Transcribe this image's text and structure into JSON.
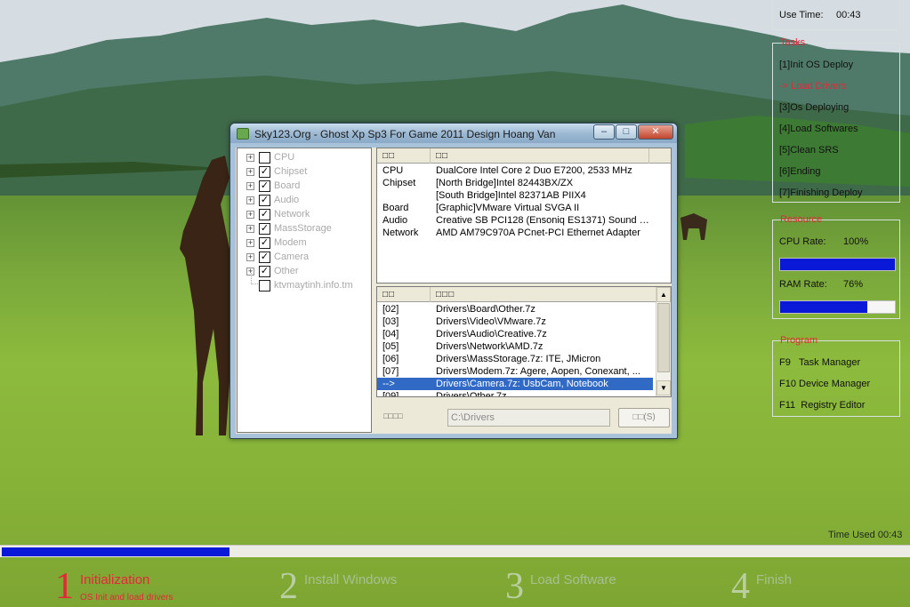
{
  "window": {
    "title": "Sky123.Org - Ghost Xp Sp3 For Game 2011 Design Hoang Van",
    "min_glyph": "–",
    "max_glyph": "□",
    "close_glyph": "✕"
  },
  "tree": {
    "items": [
      {
        "label": "CPU",
        "checked": false
      },
      {
        "label": "Chipset",
        "checked": true
      },
      {
        "label": "Board",
        "checked": true
      },
      {
        "label": "Audio",
        "checked": true
      },
      {
        "label": "Network",
        "checked": true
      },
      {
        "label": "MassStorage",
        "checked": true
      },
      {
        "label": "Modem",
        "checked": true
      },
      {
        "label": "Camera",
        "checked": true
      },
      {
        "label": "Other",
        "checked": true
      },
      {
        "label": "ktvmaytinh.info.tm",
        "checked": false
      }
    ]
  },
  "hardware_list": {
    "headers": [
      "□□",
      "□□"
    ],
    "rows": [
      {
        "type": "CPU",
        "value": "DualCore Intel Core 2 Duo E7200, 2533 MHz"
      },
      {
        "type": "Chipset",
        "value": "[North Bridge]Intel 82443BX/ZX"
      },
      {
        "type": "",
        "value": "[South Bridge]Intel 82371AB PIIX4"
      },
      {
        "type": "Board",
        "value": "[Graphic]VMware Virtual SVGA II"
      },
      {
        "type": "Audio",
        "value": "Creative SB PCI128 (Ensoniq ES1371) Sound C..."
      },
      {
        "type": "Network",
        "value": "AMD AM79C970A PCnet-PCI Ethernet Adapter"
      }
    ]
  },
  "driver_list": {
    "headers": [
      "□□",
      "□□□"
    ],
    "rows": [
      {
        "id": "[02]",
        "path": "Drivers\\Board\\Other.7z"
      },
      {
        "id": "[03]",
        "path": "Drivers\\Video\\VMware.7z"
      },
      {
        "id": "[04]",
        "path": "Drivers\\Audio\\Creative.7z"
      },
      {
        "id": "[05]",
        "path": "Drivers\\Network\\AMD.7z"
      },
      {
        "id": "[06]",
        "path": "Drivers\\MassStorage.7z: ITE, JMicron"
      },
      {
        "id": "[07]",
        "path": "Drivers\\Modem.7z: Agere, Aopen, Conexant, ..."
      },
      {
        "id": "-->",
        "path": "Drivers\\Camera.7z: UsbCam, Notebook"
      },
      {
        "id": "[09]",
        "path": "Drivers\\Other.7z"
      }
    ],
    "selected_index": 6,
    "scroll_up": "▲",
    "scroll_down": "▼"
  },
  "path_bar": {
    "label": "□□□□",
    "value": "C:\\Drivers",
    "button": "□□(S)"
  },
  "use_time": {
    "label": "Use Time:",
    "value": "00:43"
  },
  "tasks": {
    "title": "Tasks",
    "items": [
      {
        "label": "[1]Init OS Deploy",
        "active": false
      },
      {
        "label": "-> Load Drivers",
        "active": true
      },
      {
        "label": "[3]Os Deploying",
        "active": false
      },
      {
        "label": "[4]Load Softwares",
        "active": false
      },
      {
        "label": "[5]Clean SRS",
        "active": false
      },
      {
        "label": "[6]Ending",
        "active": false
      },
      {
        "label": "[7]Finishing Deploy",
        "active": false
      }
    ]
  },
  "resource": {
    "title": "Resource",
    "cpu": {
      "label": "CPU Rate:",
      "value": "100%",
      "fraction": 1.0
    },
    "ram": {
      "label": "RAM Rate:",
      "value": "76%",
      "fraction": 0.76
    }
  },
  "program": {
    "title": "Program",
    "items": [
      {
        "key": "F9",
        "label": "Task Manager"
      },
      {
        "key": "F10",
        "label": "Device Manager"
      },
      {
        "key": "F11",
        "label": "Registry Editor"
      }
    ]
  },
  "overall_progress": {
    "fraction": 0.25
  },
  "time_used": "Time Used 00:43",
  "steps": [
    {
      "num": "1",
      "title": "Initialization",
      "sub": "OS Init and load drivers",
      "active": true
    },
    {
      "num": "2",
      "title": "Install Windows",
      "sub": "",
      "active": false
    },
    {
      "num": "3",
      "title": "Load Software",
      "sub": "",
      "active": false
    },
    {
      "num": "4",
      "title": "Finish",
      "sub": "",
      "active": false
    }
  ],
  "colors": {
    "accent_red": "#e8263a",
    "progress_blue": "#0a18d8",
    "selection_blue": "#316ac5"
  }
}
